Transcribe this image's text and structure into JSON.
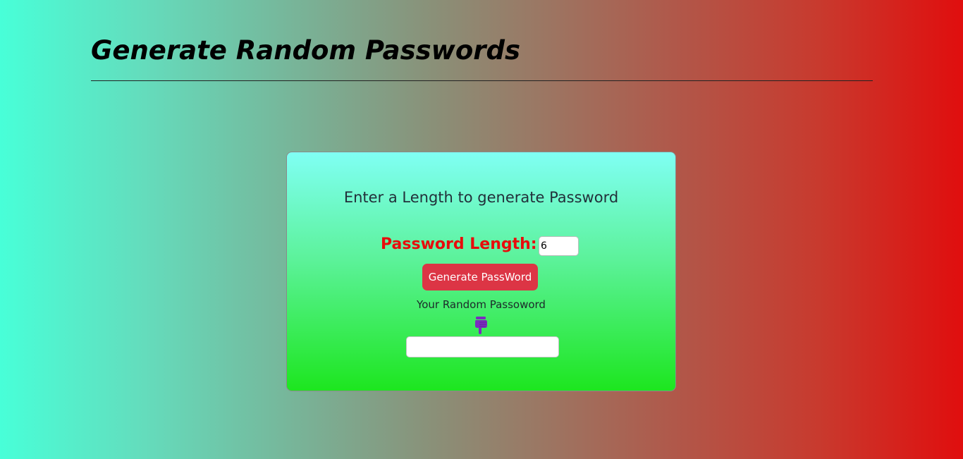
{
  "header": {
    "title": "Generate Random Passwords"
  },
  "card": {
    "heading": "Enter a Length to generate Password",
    "length_label": "Password Length:",
    "length_value": "6",
    "generate_button_label": "Generate PassWord",
    "result_label": "Your Random Passoword",
    "result_value": "",
    "pointer_icon": "hand-pointing-down-icon"
  },
  "colors": {
    "length_label": "#e80c0c",
    "button_bg": "#dc3545",
    "pointer_icon": "#7b2cbf"
  }
}
